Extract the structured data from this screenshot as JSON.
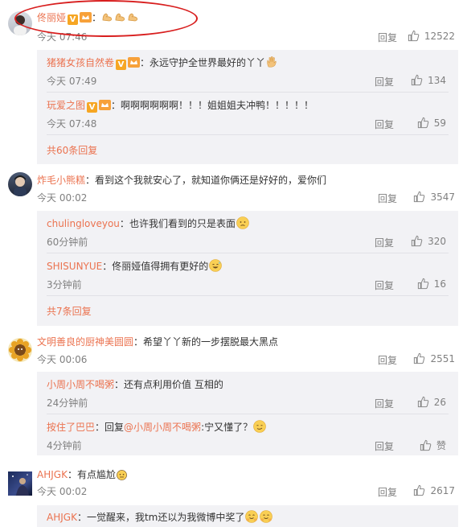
{
  "reply_label": "回复",
  "comments": [
    {
      "user": "佟丽娅",
      "sep": "：",
      "time": "今天 07:46",
      "likes": "12522",
      "replies": [
        {
          "user": "猪猪女孩自然卷",
          "sep": "：",
          "text": "永远守护全世界最好的丫丫",
          "time": "今天 07:49",
          "likes": "134"
        },
        {
          "user": "玩爱之图",
          "sep": "：",
          "text": "啊啊啊啊啊啊！！！姐姐姐夫冲鸭！！！！！",
          "time": "今天 07:48",
          "likes": "59"
        }
      ],
      "more": "共60条回复"
    },
    {
      "user": "炸毛小熊糕",
      "sep": "：",
      "text": "看到这个我就安心了，就知道你俩还是好好的，爱你们",
      "time": "今天 00:02",
      "likes": "3547",
      "replies": [
        {
          "user": "chulingloveyou",
          "sep": "：",
          "text": "也许我们看到的只是表面",
          "time": "60分钟前",
          "likes": "320"
        },
        {
          "user": "SHISUNYUE",
          "sep": "：",
          "text": "佟丽娅值得拥有更好的",
          "time": "3分钟前",
          "likes": "16"
        }
      ],
      "more": "共7条回复"
    },
    {
      "user": "文明善良的厨神美圆圆",
      "sep": "：",
      "text": "希望丫丫新的一步摆脱最大黑点",
      "time": "今天 00:06",
      "likes": "2551",
      "replies": [
        {
          "user": "小周小周不喝粥",
          "sep": "：",
          "text": "还有点利用价值 互相的",
          "time": "24分钟前",
          "likes": "26"
        },
        {
          "user": "按住了巴巴",
          "sep": "：",
          "pre": "回复",
          "mention": "@小周小周不喝粥",
          "text": ":宁又懂了？",
          "time": "4分钟前",
          "likes": "赞"
        }
      ]
    },
    {
      "user": "AHJGK",
      "sep": "：",
      "text": "有点尴尬",
      "time": "今天 00:02",
      "likes": "2617",
      "replies": [
        {
          "user": "AHJGK",
          "sep": "：",
          "text": "一觉醒来，我tm还以为我微博中奖了"
        }
      ]
    }
  ],
  "colors": {
    "username": "#eb7350",
    "meta": "#808080",
    "reply_bg": "#f2f2f5",
    "annotation": "#d81e1e"
  }
}
